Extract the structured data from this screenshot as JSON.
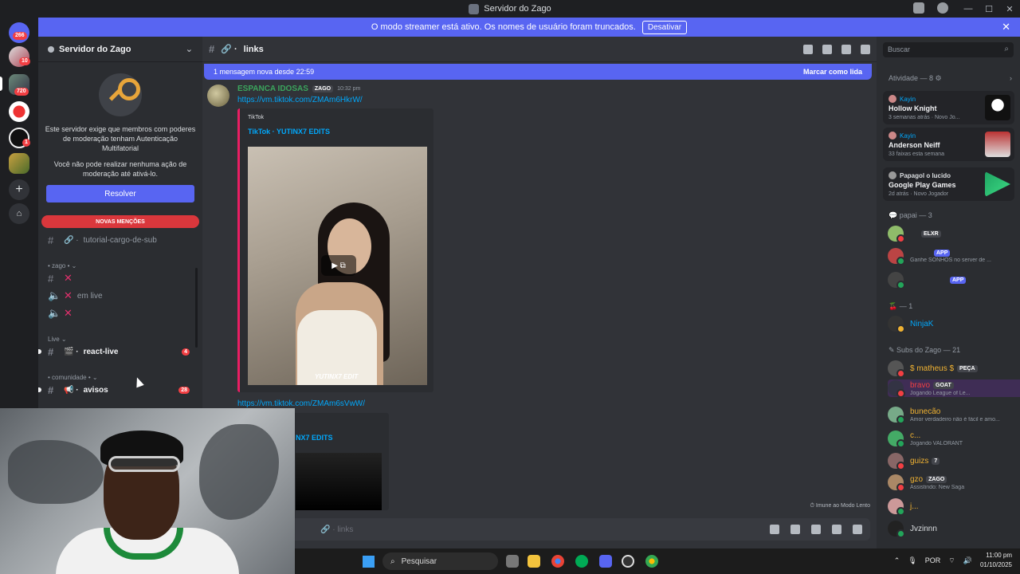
{
  "window": {
    "title": "Servidor do Zago",
    "controls": [
      "—",
      "☐",
      "✕"
    ]
  },
  "streamer_bar": {
    "text": "O modo streamer está ativo. Os nomes de usuário foram truncados.",
    "button": "Desativar",
    "close": "✕"
  },
  "rail": {
    "dm_badge": "266",
    "servers": [
      {
        "badge": "10"
      },
      {
        "badge": "720"
      },
      {
        "badge": ""
      },
      {
        "badge": "1"
      },
      {
        "badge": ""
      }
    ],
    "add": "+",
    "explore": "⌂"
  },
  "sidebar": {
    "server_name": "Servidor do Zago",
    "chevron": "⌄",
    "mfa_text_1": "Este servidor exige que membros com poderes de moderação tenham Autenticação Multifatorial",
    "mfa_text_2": "Você não pode realizar nenhuma ação de moderação até ativá-lo.",
    "resolve_button": "Resolver",
    "mentions_pill": "NOVAS MENÇÕES",
    "channels": [
      {
        "name": "tutorial-cargo-de-sub",
        "type": "link"
      }
    ],
    "cat_zago": "• zago • ⌄",
    "zago_channels": [
      {
        "label": "",
        "type": "text"
      },
      {
        "label": "em live",
        "type": "voice"
      },
      {
        "label": "",
        "type": "voice"
      }
    ],
    "cat_live": "Live ⌄",
    "react_live": {
      "name": "react-live",
      "count": "4"
    },
    "cat_comunidade": "• comunidade • ⌄",
    "avisos": {
      "name": "avisos",
      "count": "28"
    }
  },
  "chat": {
    "channel": "links",
    "new_messages": "1 mensagem nova desde 22:59",
    "mark_read": "Marcar como lida",
    "message": {
      "author": "ESPANCA IDOSAS",
      "tag": "ZAGO",
      "time": "10:32 pm",
      "link1": "https://vm.tiktok.com/ZMAm6HkrW/",
      "embed_provider": "TikTok",
      "embed_title": "TikTok · YUTINX7 EDITS",
      "watermark": "YUTINX7 EDIT",
      "link2": "https://vm.tiktok.com/ZMAm6sVwW/",
      "embed2_title": "NX7 EDITS"
    },
    "slow_mode": "Imune ao Modo Lento",
    "composer_placeholder": "links"
  },
  "members": {
    "search_placeholder": "Buscar",
    "activity_header": "Atividade — 8",
    "activities": [
      {
        "user": "Kayin",
        "title": "Hollow Knight",
        "meta": "3 semanas atrás · Novo Jo..."
      },
      {
        "user": "Kayin",
        "title": "Anderson Neiff",
        "meta": "33 faixas esta semana"
      },
      {
        "user": "Papagol o lucido",
        "title": "Google Play Games",
        "meta": "2d atrás · Novo Jogador"
      }
    ],
    "group_papai": "papai — 3",
    "papai": [
      {
        "name": "",
        "tag": "ELXR",
        "sub": ""
      },
      {
        "name": "",
        "tag": "APP",
        "sub": "Ganhe SONHOS no server de ..."
      },
      {
        "name": "",
        "tag": "APP",
        "sub": ""
      }
    ],
    "group_cherry": "— 1",
    "ninjak": "NinjaK",
    "group_subs": "Subs do Zago — 21",
    "subs": [
      {
        "name": "$ matheus $",
        "tag": "PEÇA",
        "sub": "",
        "color": "#f0b232"
      },
      {
        "name": "bravo",
        "tag": "GOAT",
        "sub": "Jogando League of Le...",
        "color": "#f23f43"
      },
      {
        "name": "bunecão",
        "tag": "",
        "sub": "Amor verdadeiro não é fácil e amo...",
        "color": "#f0b232"
      },
      {
        "name": "c...",
        "tag": "",
        "sub": "Jogando VALORANT",
        "color": "#f0b232"
      },
      {
        "name": "guizs",
        "tag": "7",
        "sub": "",
        "color": "#f0b232"
      },
      {
        "name": "gzo",
        "tag": "ZAGO",
        "sub": "Assistindo: New Saga",
        "color": "#f0b232"
      },
      {
        "name": "j...",
        "tag": "",
        "sub": "",
        "color": "#f0b232"
      },
      {
        "name": "Jvzinnn",
        "tag": "",
        "sub": "",
        "color": "#dbdee1"
      }
    ]
  },
  "taskbar": {
    "search": "Pesquisar",
    "lang": "POR",
    "time": "11:00 pm",
    "date": "01/10/2025"
  }
}
